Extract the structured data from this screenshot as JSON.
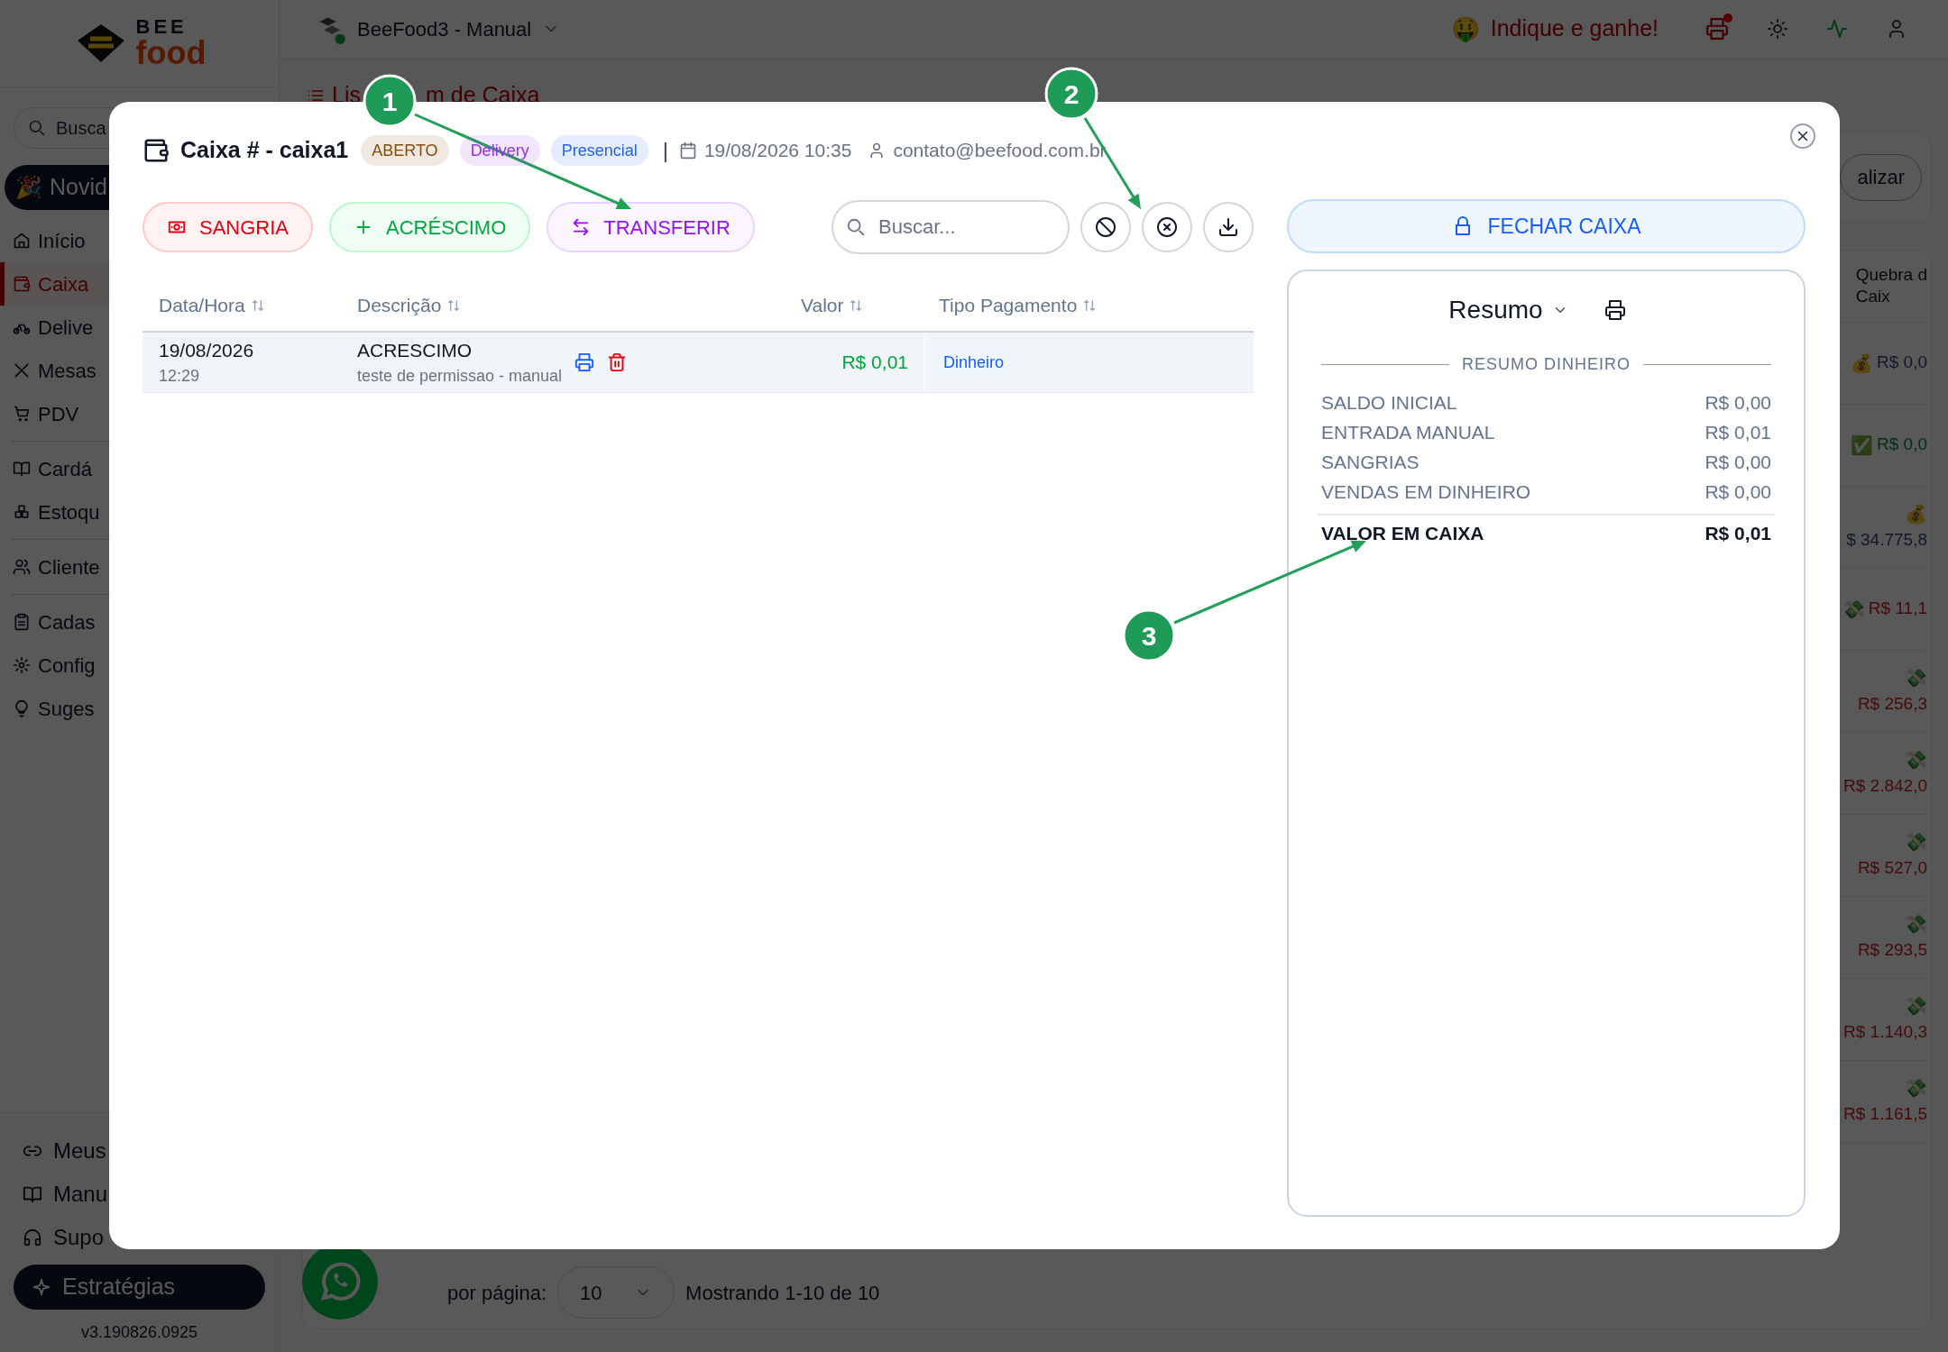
{
  "app": {
    "logo": {
      "line_1": "BEE",
      "line_2": "food"
    },
    "search_placeholder": "Busca",
    "news_emoji": "🎉",
    "news_button": "Novid",
    "nav_groups": [
      [
        {
          "label": "Início",
          "selected": false
        },
        {
          "label": "Caixa",
          "selected": true
        },
        {
          "label": "Delive",
          "selected": false
        },
        {
          "label": "Mesas",
          "selected": false
        },
        {
          "label": "PDV",
          "selected": false
        }
      ],
      [
        {
          "label": "Cardá",
          "selected": false
        },
        {
          "label": "Estoqu",
          "selected": false
        }
      ],
      [
        {
          "label": "Cliente",
          "selected": false
        }
      ],
      [
        {
          "label": "Cadas",
          "selected": false
        },
        {
          "label": "Config",
          "selected": false
        },
        {
          "label": "Suges",
          "selected": false
        }
      ]
    ],
    "footer_links": [
      "Meus",
      "Manu",
      "Supo"
    ],
    "strategy_button": "Estratégias",
    "version": "v3.190826.0925"
  },
  "header": {
    "store": "BeeFood3 - Manual",
    "referral_emoji": "🤑",
    "referral": "Indique e ganhe!"
  },
  "page": {
    "title_start": "Lis",
    "title_end": "m de Caixa",
    "update_button": "alizar",
    "column_header": [
      "Quebra d",
      "Caix"
    ],
    "cells": [
      {
        "emoji": "💰",
        "value": "R$ 0,0",
        "color": "#111827",
        "stacked": false
      },
      {
        "emoji": "✅",
        "value": "R$ 0,0",
        "color": "#052e16",
        "stacked": false
      },
      {
        "emoji": "💰",
        "value": "$ 34.775,8",
        "color": "#111827",
        "stacked": true
      },
      {
        "emoji": "💸",
        "value": "R$ 11,1",
        "color": "#450a0a",
        "stacked": false
      },
      {
        "emoji": "💸",
        "value": "R$ 256,3",
        "color": "#450a0a",
        "stacked": true
      },
      {
        "emoji": "💸",
        "value": "R$ 2.842,0",
        "color": "#450a0a",
        "stacked": true
      },
      {
        "emoji": "💸",
        "value": "R$ 527,0",
        "color": "#450a0a",
        "stacked": true
      },
      {
        "emoji": "💸",
        "value": "R$ 293,5",
        "color": "#450a0a",
        "stacked": true
      },
      {
        "emoji": "💸",
        "value": "R$ 1.140,3",
        "color": "#450a0a",
        "stacked": true
      },
      {
        "emoji": "💸",
        "value": "R$ 1.161,5",
        "color": "#450a0a",
        "stacked": true
      }
    ],
    "per_page_label": "por página:",
    "per_page": "10",
    "showing": "Mostrando 1-10 de 10"
  },
  "modal": {
    "title": "Caixa # - caixa1",
    "badges": [
      {
        "label": "ABERTO",
        "color": "#854d0e"
      },
      {
        "label": "Delivery",
        "color": "#9333ea"
      },
      {
        "label": "Presencial",
        "color": "#2563eb"
      }
    ],
    "separator": "|",
    "opened_at": "19/08/2026 10:35",
    "user": "contato@beefood.com.br",
    "actions": [
      {
        "label": "SANGRIA",
        "kind": "sangria"
      },
      {
        "label": "ACRÉSCIMO",
        "kind": "acrescimo"
      },
      {
        "label": "TRANSFERIR",
        "kind": "transferir"
      }
    ],
    "search": {
      "placeholder": "Buscar..."
    },
    "tool_buttons": [
      {
        "kind": "block"
      },
      {
        "kind": "cancel"
      },
      {
        "kind": "download"
      }
    ],
    "table": {
      "columns": [
        "Data/Hora",
        "Descrição",
        "Valor",
        "Tipo Pagamento"
      ],
      "rows": [
        {
          "date": "19/08/2026",
          "time": "12:29",
          "description": "ACRESCIMO",
          "note": "teste de permissao - manual",
          "value": "R$ 0,01",
          "payment": "Dinheiro"
        }
      ]
    },
    "close_register_button": "FECHAR CAIXA",
    "summary": {
      "title": "Resumo",
      "section": "RESUMO DINHEIRO",
      "lines": [
        {
          "label": "SALDO INICIAL",
          "value": "R$ 0,00"
        },
        {
          "label": "ENTRADA MANUAL",
          "value": "R$ 0,01"
        },
        {
          "label": "SANGRIAS",
          "value": "R$ 0,00"
        },
        {
          "label": "VENDAS EM DINHEIRO",
          "value": "R$ 0,00"
        }
      ],
      "total": {
        "label": "VALOR EM CAIXA",
        "value": "R$ 0,01"
      }
    }
  },
  "annotations": [
    {
      "label": "1"
    },
    {
      "label": "2"
    },
    {
      "label": "3"
    }
  ]
}
